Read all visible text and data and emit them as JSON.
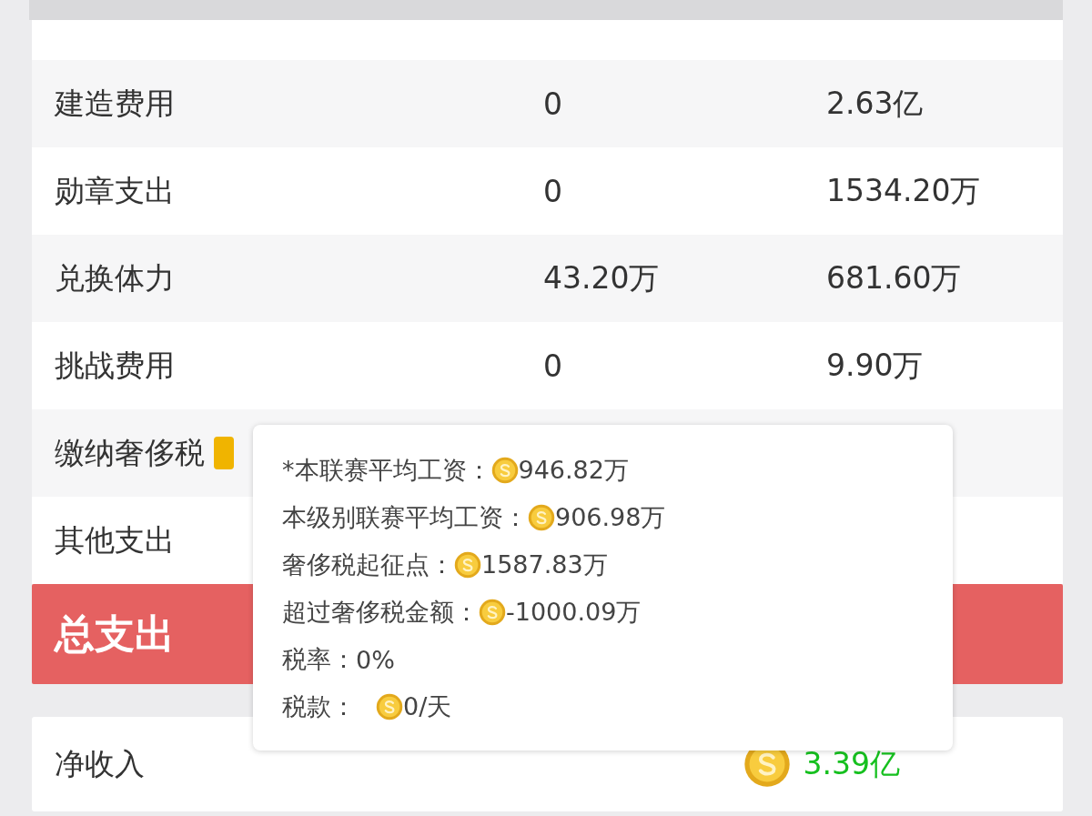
{
  "expense_rows": [
    {
      "label": "建造费用",
      "column_2": "0",
      "column_3": "2.63亿",
      "kind": "plain"
    },
    {
      "label": "勋章支出",
      "column_2": "0",
      "column_3": "1534.20万",
      "kind": "plain"
    },
    {
      "label": "兑换体力",
      "column_2": "43.20万",
      "column_3": "681.60万",
      "kind": "plain"
    },
    {
      "label": "挑战费用",
      "column_2": "0",
      "column_3": "9.90万",
      "kind": "plain"
    },
    {
      "label": "缴纳奢侈税",
      "kind": "info"
    },
    {
      "label": "其他支出",
      "kind": "plain"
    }
  ],
  "total_row": {
    "label": "总支出"
  },
  "tooltip": {
    "lines": [
      {
        "label": "*本联赛平均工资：",
        "value": "946.82万",
        "kind": "coin"
      },
      {
        "label": "本级别联赛平均工资：",
        "value": "906.98万",
        "kind": "coin"
      },
      {
        "label": "奢侈税起征点：",
        "value": "1587.83万",
        "kind": "coin"
      },
      {
        "label": "超过奢侈税金额：",
        "value": "-1000.09万",
        "kind": "coin"
      },
      {
        "label": "税率：",
        "value": "0%",
        "kind": "text"
      },
      {
        "label": "税款：",
        "value": "0/天",
        "kind": "coin"
      }
    ]
  },
  "net_income": {
    "label": "净收入",
    "value": "3.39亿"
  }
}
